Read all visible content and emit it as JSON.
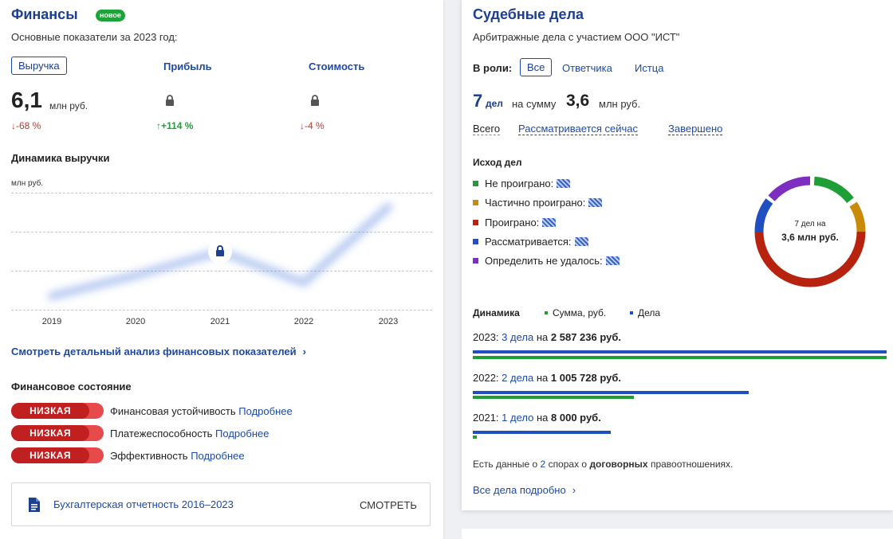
{
  "finance": {
    "title": "Финансы",
    "badge": "новое",
    "subtitle": "Основные показатели за 2023 год:",
    "tabs": {
      "revenue": "Выручка",
      "profit": "Прибыль",
      "value": "Стоимость"
    },
    "revenue_value": "6,1",
    "revenue_unit": "млн руб.",
    "revenue_change": "↓-68 %",
    "profit_change": "↑+114 %",
    "value_change": "↓-4 %",
    "chart_title": "Динамика выручки",
    "chart_unit": "млн руб.",
    "detail_link": "Смотреть детальный анализ финансовых показателей",
    "state_title": "Финансовое состояние",
    "states": [
      {
        "badge": "НИЗКАЯ",
        "label": "Финансовая устойчивость",
        "link": "Подробнее"
      },
      {
        "badge": "НИЗКАЯ",
        "label": "Платежеспособность",
        "link": "Подробнее"
      },
      {
        "badge": "НИЗКАЯ",
        "label": "Эффективность",
        "link": "Подробнее"
      }
    ],
    "reports_label": "Бухгалтерская отчетность 2016–2023",
    "reports_button": "СМОТРЕТЬ"
  },
  "chart_data": {
    "type": "line",
    "title": "Динамика выручки",
    "ylabel": "млн руб.",
    "categories": [
      "2019",
      "2020",
      "2021",
      "2022",
      "2023"
    ],
    "values_hidden": true,
    "colors": {
      "line": "#3b6fd8",
      "lock": "#1d3f8f"
    }
  },
  "court": {
    "title": "Судебные дела",
    "subtitle": "Арбитражные дела с участием ООО \"ИСТ\"",
    "roles_label": "В роли:",
    "roles": [
      "Все",
      "Ответчика",
      "Истца"
    ],
    "cases_count": "7",
    "cases_word": "дел",
    "sum_prefix": "на сумму",
    "sum_value": "3,6",
    "sum_unit": "млн руб.",
    "filters": [
      "Всего",
      "Рассматривается сейчас",
      "Завершено"
    ],
    "outcome_title": "Исход дел",
    "outcomes": [
      {
        "label": "Не проиграно:",
        "color": "#1f9e35"
      },
      {
        "label": "Частично проиграно:",
        "color": "#c98a0a"
      },
      {
        "label": "Проиграно:",
        "color": "#b8230f"
      },
      {
        "label": "Рассматривается:",
        "color": "#1f4fc0"
      },
      {
        "label": "Определить не удалось:",
        "color": "#7b2ec0"
      }
    ],
    "donut_line1": "7 дел на",
    "donut_line2": "3,6 млн руб.",
    "dynamics_title": "Динамика",
    "legend_sum": "Сумма, руб.",
    "legend_cases": "Дела",
    "years": [
      {
        "year": "2023:",
        "cases": "3 дела",
        "on": "на",
        "sum": "2 587 236 руб.",
        "blue_frac": 1.0,
        "green_frac": 1.0
      },
      {
        "year": "2022:",
        "cases": "2 дела",
        "on": "на",
        "sum": "1 005 728 руб.",
        "blue_frac": 0.667,
        "green_frac": 0.389
      },
      {
        "year": "2021:",
        "cases": "1 дело",
        "on": "на",
        "sum": "8 000 руб.",
        "blue_frac": 0.333,
        "green_frac": 0.01
      }
    ],
    "footer_prefix": "Есть данные о",
    "footer_count": "2",
    "footer_mid": "спорах о",
    "footer_bold": "договорных",
    "footer_suffix": "правоотношениях.",
    "all_cases_link": "Все дела подробно"
  }
}
